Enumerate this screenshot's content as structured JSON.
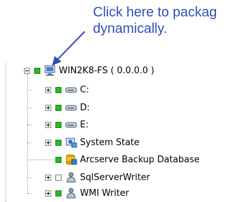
{
  "callout": {
    "line1": "Click here to packag",
    "line2": "dynamically."
  },
  "colors": {
    "callout": "#2f4fb8",
    "check_green": "#29b829"
  },
  "tree": {
    "root": {
      "label": "WIN2K8-FS ( 0.0.0.0 )",
      "icon": "computer-icon",
      "expanded": true,
      "checked": true
    },
    "children": [
      {
        "label": "C:",
        "icon": "drive-icon",
        "expander": "plus",
        "checked": true
      },
      {
        "label": "D:",
        "icon": "drive-icon",
        "expander": "plus",
        "checked": true
      },
      {
        "label": "E:",
        "icon": "drive-icon",
        "expander": "plus",
        "checked": true
      },
      {
        "label": "System State",
        "icon": "system-state-icon",
        "expander": "plus",
        "checked": true
      },
      {
        "label": "Arcserve Backup Database",
        "icon": "database-icon",
        "expander": "none",
        "checked": true
      },
      {
        "label": "SqlServerWriter",
        "icon": "writer-icon",
        "expander": "plus",
        "checked": false
      },
      {
        "label": "WMI Writer",
        "icon": "writer-icon",
        "expander": "plus",
        "checked": true
      }
    ]
  }
}
